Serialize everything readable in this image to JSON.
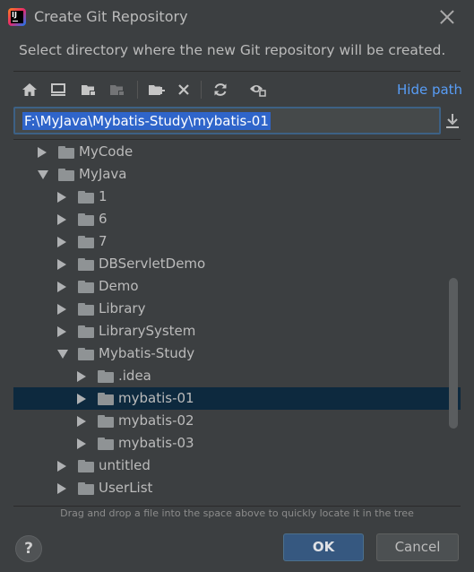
{
  "window": {
    "title": "Create Git Repository",
    "description": "Select directory where the new Git repository will be created."
  },
  "toolbar": {
    "icons": [
      "home-icon",
      "desktop-icon",
      "project-folder-icon",
      "module-folder-icon",
      "new-folder-icon",
      "delete-icon",
      "refresh-icon",
      "show-hidden-icon"
    ],
    "hide_path_label": "Hide path"
  },
  "path": {
    "value": "F:\\MyJava\\Mybatis-Study\\mybatis-01"
  },
  "tree": {
    "rows": [
      {
        "label": "MyCode",
        "expanded": false,
        "depth": 1,
        "selected": false
      },
      {
        "label": "MyJava",
        "expanded": true,
        "depth": 1,
        "selected": false
      },
      {
        "label": "1",
        "expanded": false,
        "depth": 2,
        "selected": false
      },
      {
        "label": "6",
        "expanded": false,
        "depth": 2,
        "selected": false
      },
      {
        "label": "7",
        "expanded": false,
        "depth": 2,
        "selected": false
      },
      {
        "label": "DBServletDemo",
        "expanded": false,
        "depth": 2,
        "selected": false
      },
      {
        "label": "Demo",
        "expanded": false,
        "depth": 2,
        "selected": false
      },
      {
        "label": "Library",
        "expanded": false,
        "depth": 2,
        "selected": false
      },
      {
        "label": "LibrarySystem",
        "expanded": false,
        "depth": 2,
        "selected": false
      },
      {
        "label": "Mybatis-Study",
        "expanded": true,
        "depth": 2,
        "selected": false
      },
      {
        "label": ".idea",
        "expanded": false,
        "depth": 3,
        "selected": false
      },
      {
        "label": "mybatis-01",
        "expanded": false,
        "depth": 3,
        "selected": true
      },
      {
        "label": "mybatis-02",
        "expanded": false,
        "depth": 3,
        "selected": false
      },
      {
        "label": "mybatis-03",
        "expanded": false,
        "depth": 3,
        "selected": false
      },
      {
        "label": "untitled",
        "expanded": false,
        "depth": 2,
        "selected": false
      },
      {
        "label": "UserList",
        "expanded": false,
        "depth": 2,
        "selected": false
      }
    ]
  },
  "hint": "Drag and drop a file into the space above to quickly locate it in the tree",
  "buttons": {
    "help": "?",
    "ok": "OK",
    "cancel": "Cancel"
  },
  "colors": {
    "background": "#3c3f41",
    "selection": "#0d293e",
    "link": "#589df6",
    "primary_button": "#365880"
  }
}
